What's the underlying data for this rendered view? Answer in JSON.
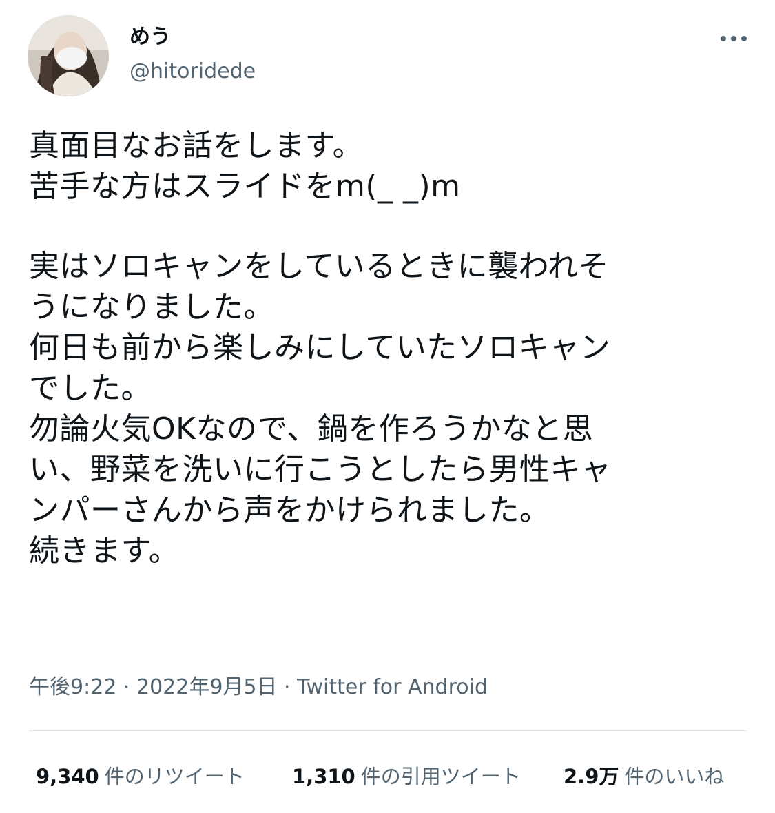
{
  "author": {
    "display_name": "めう",
    "handle": "@hitoridede"
  },
  "tweet": {
    "lines": [
      "真面目なお話をします。",
      "苦手な方はスライドをm(_ _)m",
      "",
      "実はソロキャンをしているときに襲われそ",
      "うになりました。",
      "何日も前から楽しみにしていたソロキャン",
      "でした。",
      "勿論火気OKなので、鍋を作ろうかなと思",
      "い、野菜を洗いに行こうとしたら男性キャ",
      "ンパーさんから声をかけられました。",
      "続きます。"
    ]
  },
  "meta": {
    "time": "午後9:22",
    "separator1": " · ",
    "date": "2022年9月5日",
    "separator2": " · ",
    "source": "Twitter for Android"
  },
  "stats": {
    "retweets": {
      "count": "9,340",
      "label": "件のリツイート"
    },
    "quotes": {
      "count": "1,310",
      "label": "件の引用ツイート"
    },
    "likes": {
      "count": "2.9万",
      "label": "件のいいね"
    }
  },
  "icons": {
    "more": "more-horizontal-icon"
  },
  "colors": {
    "text_primary": "#0f1419",
    "text_secondary": "#536471",
    "divider": "#e1e6ea"
  }
}
